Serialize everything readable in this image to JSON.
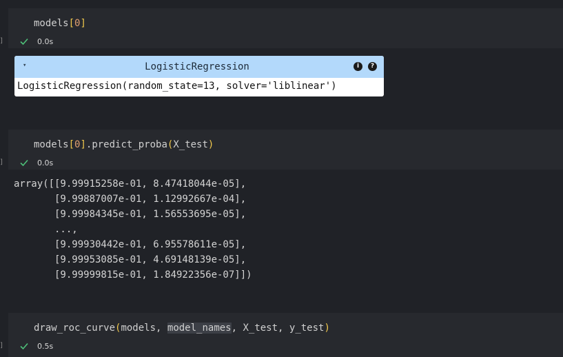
{
  "cells": [
    {
      "code": {
        "name": "models",
        "open": "[",
        "index": "0",
        "close": "]"
      },
      "bracket": "]",
      "time": "0.0s"
    },
    {
      "code": {
        "name": "models",
        "open": "[",
        "index": "0",
        "close": "]",
        "method": ".predict_proba",
        "paren_open": "(",
        "arg": "X_test",
        "paren_close": ")"
      },
      "bracket": "]",
      "time": "0.0s"
    },
    {
      "code": {
        "fn": "draw_roc_curve",
        "paren_open": "(",
        "arg1": "models, ",
        "arg2": "model_names",
        "arg3": ", X_test, y_test",
        "paren_close": ")"
      },
      "bracket": "]",
      "time": "0.5s"
    }
  ],
  "widget": {
    "toggle": "▾",
    "title": "LogisticRegression",
    "info_icon": "i",
    "help_icon": "?",
    "body": "LogisticRegression(random_state=13, solver='liblinear')"
  },
  "array_output": [
    "array([[9.99915258e-01, 8.47418044e-05],",
    "       [9.99887007e-01, 1.12992667e-04],",
    "       [9.99984345e-01, 1.56553695e-05],",
    "       ...,",
    "       [9.99930442e-01, 6.95578611e-05],",
    "       [9.99953085e-01, 4.69148139e-05],",
    "       [9.99999815e-01, 1.84922356e-07]])"
  ],
  "colors": {
    "background": "#202227",
    "cell": "#27292e",
    "bracket": "#f2c94c",
    "widget_header": "#b3d9fb",
    "check": "#4ec27a"
  },
  "icons": {
    "status": "check-icon",
    "widget_info": "info-icon",
    "widget_help": "help-icon"
  }
}
